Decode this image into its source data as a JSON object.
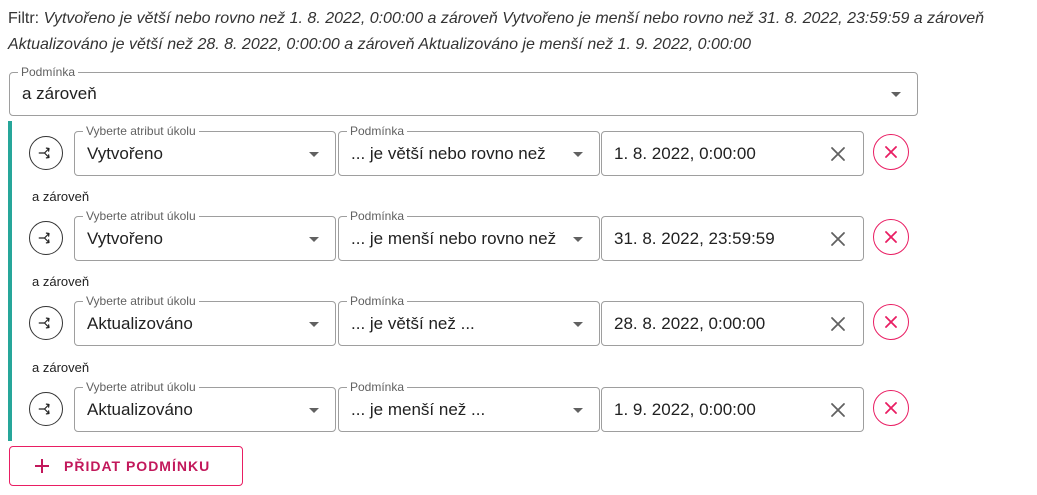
{
  "filter": {
    "prefix": "Filtr:",
    "expression": "Vytvořeno je větší nebo rovno než 1. 8. 2022, 0:00:00 a zároveň Vytvořeno je menší nebo rovno než 31. 8. 2022, 23:59:59 a zároveň Aktualizováno je větší než 28. 8. 2022, 0:00:00 a zároveň Aktualizováno je menší než 1. 9. 2022, 0:00:00"
  },
  "top_condition": {
    "label": "Podmínka",
    "value": "a zároveň"
  },
  "rows": [
    {
      "attr_label": "Vyberte atribut úkolu",
      "attr_value": "Vytvořeno",
      "cond_label": "Podmínka",
      "cond_value": "... je větší nebo rovno než",
      "value": "1. 8. 2022, 0:00:00"
    },
    {
      "conj": "a zároveň",
      "attr_label": "Vyberte atribut úkolu",
      "attr_value": "Vytvořeno",
      "cond_label": "Podmínka",
      "cond_value": "... je menší nebo rovno než",
      "value": "31. 8. 2022, 23:59:59"
    },
    {
      "conj": "a zároveň",
      "attr_label": "Vyberte atribut úkolu",
      "attr_value": "Aktualizováno",
      "cond_label": "Podmínka",
      "cond_value": "... je větší než ...",
      "value": "28. 8. 2022, 0:00:00"
    },
    {
      "conj": "a zároveň",
      "attr_label": "Vyberte atribut úkolu",
      "attr_value": "Aktualizováno",
      "cond_label": "Podmínka",
      "cond_value": "... je menší než ...",
      "value": "1. 9. 2022, 0:00:00"
    }
  ],
  "add_button": {
    "label": "PŘIDAT PODMÍNKU"
  },
  "icons": {
    "branch": "branch-icon",
    "remove": "close-icon",
    "clear": "clear-icon",
    "dropdown": "dropdown-arrow-icon",
    "add": "plus-icon"
  },
  "colors": {
    "accent": "#e91e63",
    "group_bar": "#26a69a"
  }
}
